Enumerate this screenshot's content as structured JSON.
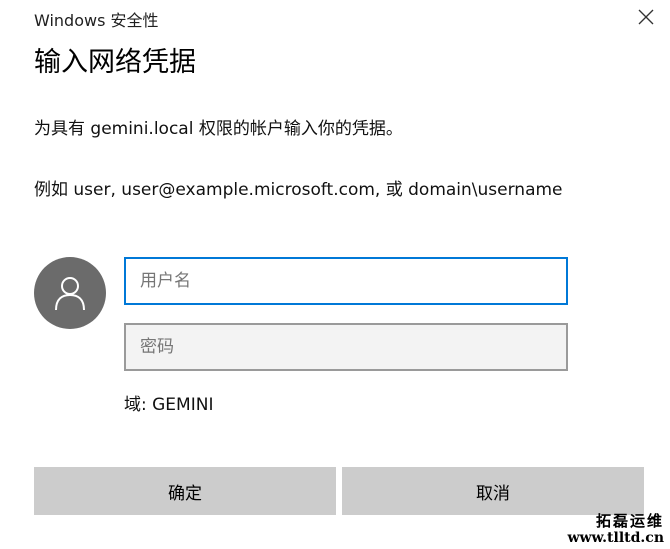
{
  "window": {
    "title": "Windows 安全性"
  },
  "dialog": {
    "heading": "输入网络凭据",
    "description": "为具有 gemini.local 权限的帐户输入你的凭据。",
    "example": "例如 user, user@example.microsoft.com, 或 domain\\username"
  },
  "form": {
    "username_placeholder": "用户名",
    "password_placeholder": "密码",
    "domain_label": "域: GEMINI"
  },
  "buttons": {
    "ok_label": "确定",
    "cancel_label": "取消"
  },
  "watermark": {
    "title": "拓磊运维",
    "url": "www.tlltd.cn"
  },
  "colors": {
    "focus_border": "#0078d7",
    "button_background": "#cccccc",
    "avatar_background": "#6b6b6b"
  },
  "icons": {
    "close": "close-icon",
    "avatar": "user-icon"
  }
}
